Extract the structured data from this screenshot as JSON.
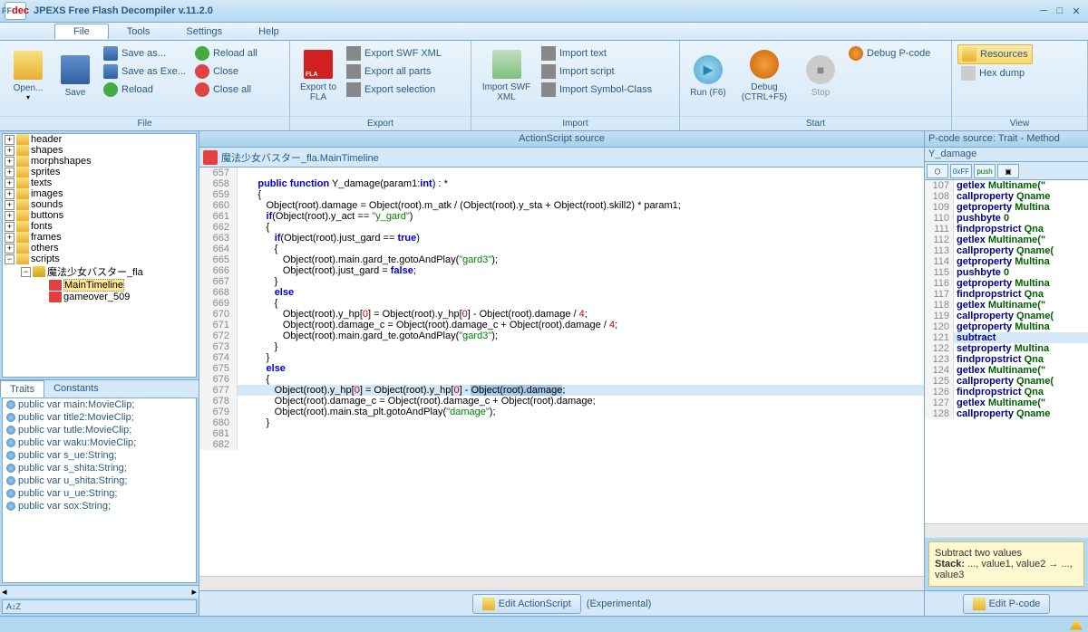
{
  "title": "JPEXS Free Flash Decompiler v.11.2.0",
  "menu": {
    "file": "File",
    "tools": "Tools",
    "settings": "Settings",
    "help": "Help"
  },
  "ribbon": {
    "file": {
      "label": "File",
      "open": "Open...",
      "save": "Save",
      "saveas": "Save as...",
      "saveexe": "Save as Exe...",
      "reload": "Reload",
      "reloadall": "Reload all",
      "close": "Close",
      "closeall": "Close all"
    },
    "export": {
      "label": "Export",
      "tofla": "Export to FLA",
      "swfxml": "Export SWF XML",
      "allparts": "Export all parts",
      "selection": "Export selection"
    },
    "import": {
      "label": "Import",
      "swfxml": "Import SWF XML",
      "text": "Import text",
      "script": "Import script",
      "symbolclass": "Import Symbol-Class"
    },
    "start": {
      "label": "Start",
      "run": "Run (F6)",
      "debug": "Debug (CTRL+F5)",
      "stop": "Stop",
      "debugpcode": "Debug P-code"
    },
    "view": {
      "label": "View",
      "resources": "Resources",
      "hexdump": "Hex dump"
    }
  },
  "tree": {
    "items": [
      {
        "label": "header",
        "exp": "+",
        "icon": "folder"
      },
      {
        "label": "shapes",
        "exp": "+",
        "icon": "folder"
      },
      {
        "label": "morphshapes",
        "exp": "+",
        "icon": "folder"
      },
      {
        "label": "sprites",
        "exp": "+",
        "icon": "folder"
      },
      {
        "label": "texts",
        "exp": "+",
        "icon": "folder"
      },
      {
        "label": "images",
        "exp": "+",
        "icon": "folder"
      },
      {
        "label": "sounds",
        "exp": "+",
        "icon": "folder"
      },
      {
        "label": "buttons",
        "exp": "+",
        "icon": "folder"
      },
      {
        "label": "fonts",
        "exp": "+",
        "icon": "folder"
      },
      {
        "label": "frames",
        "exp": "+",
        "icon": "folder"
      },
      {
        "label": "others",
        "exp": "+",
        "icon": "folder"
      },
      {
        "label": "scripts",
        "exp": "−",
        "icon": "folder"
      }
    ],
    "pkg": "魔法少女バスター_fla",
    "class1": "MainTimeline",
    "class2": "gameover_509"
  },
  "traits": {
    "tab1": "Traits",
    "tab2": "Constants",
    "items": [
      "public var main:MovieClip;",
      "public var title2:MovieClip;",
      "public var tutle:MovieClip;",
      "public var waku:MovieClip;",
      "public var s_ue:String;",
      "public var s_shita:String;",
      "public var u_shita:String;",
      "public var u_ue:String;",
      "public var sox:String;"
    ]
  },
  "source": {
    "header": "ActionScript source",
    "breadcrumb": "魔法少女バスター_fla.MainTimeline",
    "editbtn": "Edit ActionScript",
    "experimental": "(Experimental)",
    "lines": [
      {
        "n": 657,
        "t": ""
      },
      {
        "n": 658,
        "t": "      <kw>public</kw> <kw>function</kw> Y_damage(param1:<kw>int</kw>) : *"
      },
      {
        "n": 659,
        "t": "      {"
      },
      {
        "n": 660,
        "t": "         Object(root).damage = Object(root).m_atk / (Object(root).y_sta + Object(root).skill2) * param1;"
      },
      {
        "n": 661,
        "t": "         <kw>if</kw>(Object(root).y_act == <str>\"y_gard\"</str>)"
      },
      {
        "n": 662,
        "t": "         {"
      },
      {
        "n": 663,
        "t": "            <kw>if</kw>(Object(root).just_gard == <bool>true</bool>)"
      },
      {
        "n": 664,
        "t": "            {"
      },
      {
        "n": 665,
        "t": "               Object(root).main.gard_te.gotoAndPlay(<str>\"gard3\"</str>);"
      },
      {
        "n": 666,
        "t": "               Object(root).just_gard = <bool>false</bool>;"
      },
      {
        "n": 667,
        "t": "            }"
      },
      {
        "n": 668,
        "t": "            <kw>else</kw>"
      },
      {
        "n": 669,
        "t": "            {"
      },
      {
        "n": 670,
        "t": "               Object(root).y_hp[<num>0</num>] = Object(root).y_hp[<num>0</num>] - Object(root).damage / <num>4</num>;"
      },
      {
        "n": 671,
        "t": "               Object(root).damage_c = Object(root).damage_c + Object(root).damage / <num>4</num>;"
      },
      {
        "n": 672,
        "t": "               Object(root).main.gard_te.gotoAndPlay(<str>\"gard3\"</str>);"
      },
      {
        "n": 673,
        "t": "            }"
      },
      {
        "n": 674,
        "t": "         }"
      },
      {
        "n": 675,
        "t": "         <kw>else</kw>"
      },
      {
        "n": 676,
        "t": "         {"
      },
      {
        "n": 677,
        "t": "            Object(root).y_hp[<num>0</num>] = Object(root).y_hp[<num>0</num>] - <sel>Object(root).damage</sel>;",
        "hl": true
      },
      {
        "n": 678,
        "t": "            Object(root).damage_c = Object(root).damage_c + Object(root).damage;"
      },
      {
        "n": 679,
        "t": "            Object(root).main.sta_plt.gotoAndPlay(<str>\"damage\"</str>);"
      },
      {
        "n": 680,
        "t": "         }"
      },
      {
        "n": 681,
        "t": ""
      },
      {
        "n": 682,
        "t": ""
      }
    ]
  },
  "pcode": {
    "header": "P-code source: Trait - Method",
    "sub": "Y_damage",
    "editbtn": "Edit P-code",
    "lines": [
      {
        "n": 107,
        "op": "getlex",
        "arg": "Multiname(\""
      },
      {
        "n": 108,
        "op": "callproperty",
        "arg": "Qname"
      },
      {
        "n": 109,
        "op": "getproperty",
        "arg": "Multina"
      },
      {
        "n": 110,
        "op": "pushbyte",
        "arg": "0"
      },
      {
        "n": 111,
        "op": "findpropstrict",
        "arg": "Qna"
      },
      {
        "n": 112,
        "op": "getlex",
        "arg": "Multiname(\""
      },
      {
        "n": 113,
        "op": "callproperty",
        "arg": "Qname("
      },
      {
        "n": 114,
        "op": "getproperty",
        "arg": "Multina"
      },
      {
        "n": 115,
        "op": "pushbyte",
        "arg": "0"
      },
      {
        "n": 116,
        "op": "getproperty",
        "arg": "Multina"
      },
      {
        "n": 117,
        "op": "findpropstrict",
        "arg": "Qna"
      },
      {
        "n": 118,
        "op": "getlex",
        "arg": "Multiname(\""
      },
      {
        "n": 119,
        "op": "callproperty",
        "arg": "Qname("
      },
      {
        "n": 120,
        "op": "getproperty",
        "arg": "Multina"
      },
      {
        "n": 121,
        "op": "subtract",
        "arg": "",
        "hl": true
      },
      {
        "n": 122,
        "op": "setproperty",
        "arg": "Multina"
      },
      {
        "n": 123,
        "op": "findpropstrict",
        "arg": "Qna"
      },
      {
        "n": 124,
        "op": "getlex",
        "arg": "Multiname(\""
      },
      {
        "n": 125,
        "op": "callproperty",
        "arg": "Qname("
      },
      {
        "n": 126,
        "op": "findpropstrict",
        "arg": "Qna"
      },
      {
        "n": 127,
        "op": "getlex",
        "arg": "Multiname(\""
      },
      {
        "n": 128,
        "op": "callproperty",
        "arg": "Qname"
      }
    ],
    "hint": {
      "title": "Subtract two values",
      "stack_label": "Stack:",
      "stack": "..., value1, value2 → ..., value3"
    }
  }
}
